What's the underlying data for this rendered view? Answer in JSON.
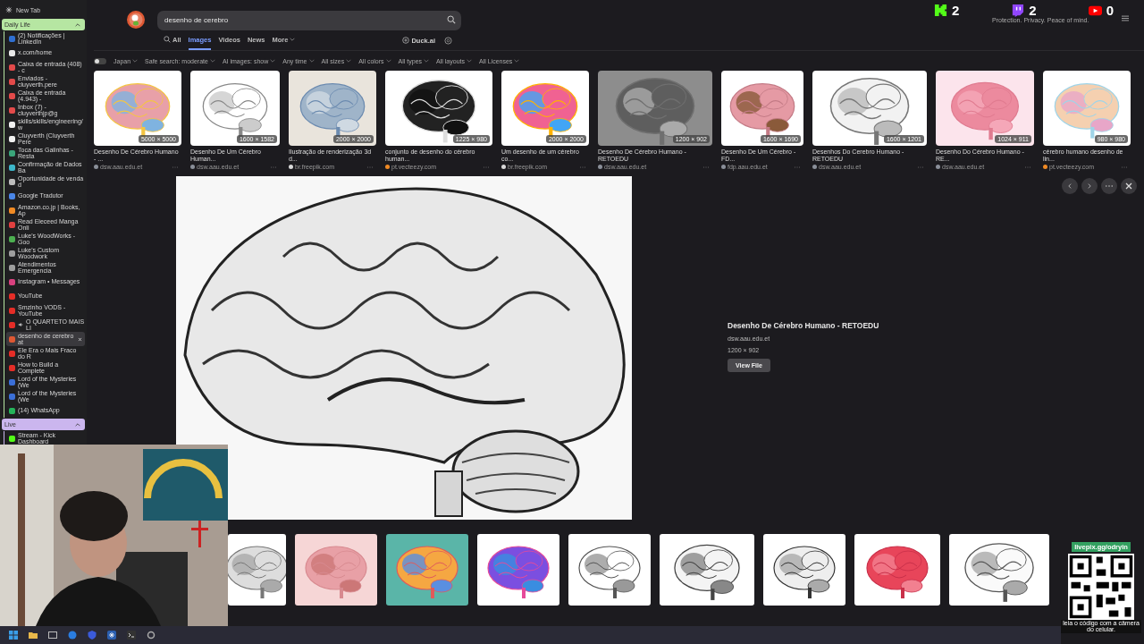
{
  "sidebar": {
    "new_tab": "New Tab",
    "groups": [
      {
        "name": "Daily Life",
        "color": "#b6e6a2",
        "expanded": true,
        "tabs": [
          {
            "title": "(2) Notificações | LinkedIn",
            "color": "#2f6fd1",
            "selected": false,
            "audio": false
          },
          {
            "title": "x.com/home",
            "color": "#e8e8e8",
            "selected": false,
            "audio": false
          },
          {
            "title": "Caixa de entrada (408) - c",
            "color": "#e34a4a",
            "selected": false,
            "audio": false
          },
          {
            "title": "Enviados - cluyverth.pere",
            "color": "#e34a4a",
            "selected": false,
            "audio": false
          },
          {
            "title": "Caixa de entrada (4.943) -",
            "color": "#e34a4a",
            "selected": false,
            "audio": false
          },
          {
            "title": "Inbox (7) - cluyverthjp@g",
            "color": "#e34a4a",
            "selected": false,
            "audio": false
          },
          {
            "title": "skills/skills/engineering/w",
            "color": "#f0f0f0",
            "selected": false,
            "audio": false
          },
          {
            "title": "Cluyverth (Cluyverth Pere",
            "color": "#f0f0f0",
            "selected": false,
            "audio": false
          },
          {
            "title": "Toca das Galinhas - Resta",
            "color": "#3aa57a",
            "selected": false,
            "audio": false
          },
          {
            "title": "Confirmação de Dados Ba",
            "color": "#3db6c9",
            "selected": false,
            "audio": false
          },
          {
            "title": "Oportunidade de venda d",
            "color": "#bdbdbd",
            "selected": false,
            "audio": false
          },
          {
            "title": "Google Tradutor",
            "color": "#4a86e8",
            "selected": false,
            "audio": false
          },
          {
            "title": "Amazon.co.jp | Books, Ap",
            "color": "#f08a24",
            "selected": false,
            "audio": false
          },
          {
            "title": "Read Eleceed Manga Onli",
            "color": "#e04040",
            "selected": false,
            "audio": false
          },
          {
            "title": "Luke's WoodWorks - Goo",
            "color": "#4caf50",
            "selected": false,
            "audio": false
          },
          {
            "title": "Luke's Custom Woodwork",
            "color": "#9e9e9e",
            "selected": false,
            "audio": false
          },
          {
            "title": "Atendimentos Emergencia",
            "color": "#9e9e9e",
            "selected": false,
            "audio": false
          },
          {
            "title": "Instagram • Messages",
            "color": "#d9417f",
            "selected": false,
            "audio": false
          },
          {
            "title": "YouTube",
            "color": "#e52d27",
            "selected": false,
            "audio": false
          },
          {
            "title": "Smzinho VODS - YouTube",
            "color": "#e52d27",
            "selected": false,
            "audio": false
          },
          {
            "title": "O QUARTETO MAIS LI",
            "color": "#e52d27",
            "selected": false,
            "audio": true
          },
          {
            "title": "desenho de cerebro at",
            "color": "#de5833",
            "selected": true,
            "audio": false
          },
          {
            "title": "Ele Era o Mais Fraco do R",
            "color": "#e52d27",
            "selected": false,
            "audio": false
          },
          {
            "title": "How to Build a Complete",
            "color": "#e52d27",
            "selected": false,
            "audio": false
          },
          {
            "title": "Lord of the Mysteries (We",
            "color": "#3b6fd8",
            "selected": false,
            "audio": false
          },
          {
            "title": "Lord of the Mysteries (We",
            "color": "#3b6fd8",
            "selected": false,
            "audio": false
          },
          {
            "title": "(14) WhatsApp",
            "color": "#25b35a",
            "selected": false,
            "audio": false
          }
        ]
      },
      {
        "name": "Live",
        "color": "#cbb6ee",
        "expanded": true,
        "tabs": [
          {
            "title": "Stream - Kick Dashboard",
            "color": "#53fc18",
            "selected": false,
            "audio": false
          }
        ]
      }
    ]
  },
  "search": {
    "query": "desenho de cerebro"
  },
  "tabs": [
    {
      "label": "All",
      "selected": false
    },
    {
      "label": "Images",
      "selected": true
    },
    {
      "label": "Videos",
      "selected": false
    },
    {
      "label": "News",
      "selected": false
    },
    {
      "label": "More",
      "selected": false
    }
  ],
  "duck_ai": "Duck.ai",
  "filters": {
    "region_on": false,
    "items": [
      "Japan",
      "Safe search: moderate",
      "AI images: show",
      "Any time",
      "All sizes",
      "All colors",
      "All types",
      "All layouts",
      "All Licenses"
    ]
  },
  "results": [
    {
      "title": "Desenho De Cérebro Humano - ...",
      "source": "dsw.aau.edu.et",
      "size": "5000 × 5000",
      "color": "#8a8f99"
    },
    {
      "title": "Desenho De Um Cérebro Human...",
      "source": "dsw.aau.edu.et",
      "size": "1600 × 1582",
      "color": "#8a8f99"
    },
    {
      "title": "Ilustração de renderização 3d d...",
      "source": "br.freepik.com",
      "size": "2000 × 2000",
      "color": "#d9d9d9"
    },
    {
      "title": "conjunto de desenho do cérebro human...",
      "source": "pt.vecteezy.com",
      "size": "1225 × 980",
      "color": "#f08a24"
    },
    {
      "title": "Um desenho de um cérebro co...",
      "source": "br.freepik.com",
      "size": "2000 × 2000",
      "color": "#d9d9d9"
    },
    {
      "title": "Desenho De Cérebro Humano - RETOEDU",
      "source": "dsw.aau.edu.et",
      "size": "1200 × 902",
      "color": "#8a8f99"
    },
    {
      "title": "Desenho De Um Cérebro - FD...",
      "source": "fdp.aau.edu.et",
      "size": "1600 × 1690",
      "color": "#8a8f99"
    },
    {
      "title": "Desenhos Do Cerebro Humano - RETOEDU",
      "source": "dsw.aau.edu.et",
      "size": "1600 × 1201",
      "color": "#8a8f99"
    },
    {
      "title": "Desenho Do Cérebro Humano - RE...",
      "source": "dsw.aau.edu.et",
      "size": "1024 × 911",
      "color": "#8a8f99"
    },
    {
      "title": "cérebro humano desenho de lin...",
      "source": "pt.vecteezy.com",
      "size": "980 × 980",
      "color": "#f08a24"
    }
  ],
  "preview": {
    "title": "Desenho De Cérebro Humano - RETOEDU",
    "source": "dsw.aau.edu.et",
    "size": "1200 × 902",
    "button": "View File"
  },
  "stream_overlay": {
    "counters": [
      {
        "kind": "kick",
        "count": "2"
      },
      {
        "kind": "twitch",
        "count": "2"
      },
      {
        "kind": "youtube",
        "count": "0"
      }
    ],
    "tagline": "Protection. Privacy. Peace of mind.",
    "qr": {
      "url": "livepix.gg/odryin",
      "caption": "leia o código com a câmera do celular."
    }
  }
}
